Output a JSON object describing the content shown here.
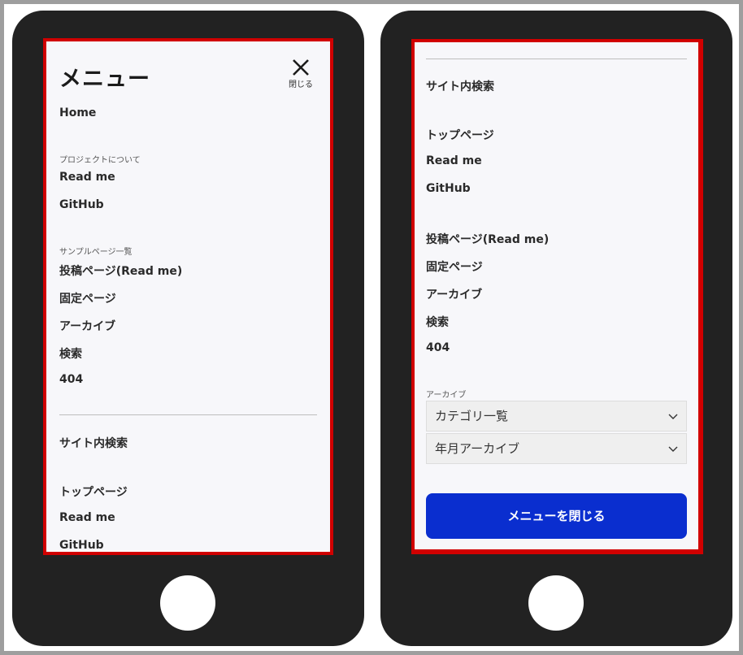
{
  "left_screen": {
    "menu_title": "メニュー",
    "close_label": "閉じる",
    "home": "Home",
    "project_label": "プロジェクトについて",
    "project_items": [
      "Read me",
      "GitHub"
    ],
    "samples_label": "サンプルページ一覧",
    "sample_items": [
      "投稿ページ(Read me)",
      "固定ページ",
      "アーカイブ",
      "検索",
      "404"
    ],
    "site_search": "サイト内検索",
    "footer_items": [
      "トップページ",
      "Read me",
      "GitHub"
    ]
  },
  "right_screen": {
    "site_search": "サイト内検索",
    "nav_items": [
      "トップページ",
      "Read me",
      "GitHub"
    ],
    "sample_items": [
      "投稿ページ(Read me)",
      "固定ページ",
      "アーカイブ",
      "検索",
      "404"
    ],
    "archive_label": "アーカイブ",
    "category_select": "カテゴリ一覧",
    "month_select": "年月アーカイブ",
    "close_menu_button": "メニューを閉じる"
  },
  "colors": {
    "phone_body": "#222222",
    "screen_outline": "#d10000",
    "primary_button": "#0a2ecf"
  },
  "icons": [
    "close-icon",
    "chevron-down-icon",
    "home-button"
  ]
}
